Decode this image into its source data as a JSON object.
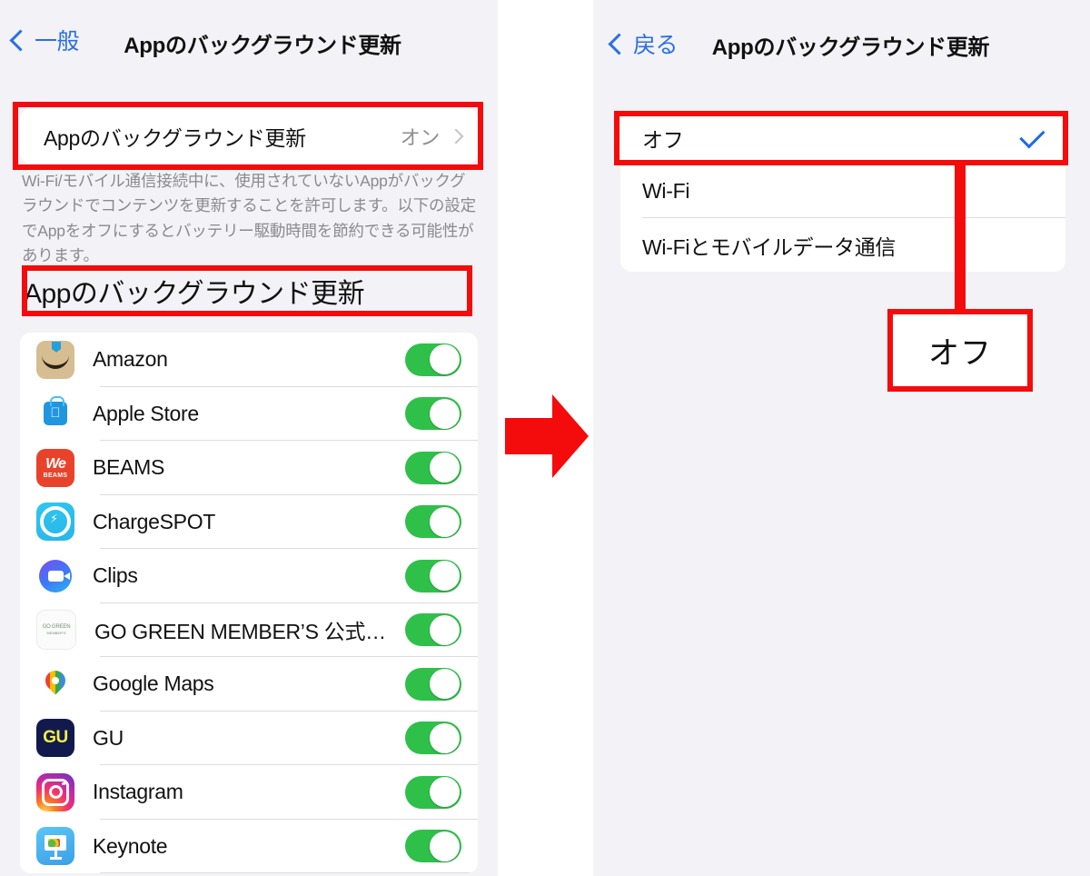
{
  "left_panel": {
    "nav": {
      "back_label": "一般",
      "title": "Appのバックグラウンド更新"
    },
    "bgrefresh_row": {
      "label": "Appのバックグラウンド更新",
      "value": "オン"
    },
    "footnote": "Wi-Fi/モバイル通信接続中に、使用されていないAppがバックグラウンドでコンテンツを更新することを許可します。以下の設定でAppをオフにするとバッテリー駆動時間を節約できる可能性があります。",
    "section_header": "Appのバックグラウンド更新",
    "apps": [
      {
        "name": "Amazon",
        "icon": "amazon-icon",
        "enabled": true
      },
      {
        "name": "Apple Store",
        "icon": "apple-store-icon",
        "enabled": true
      },
      {
        "name": "BEAMS",
        "icon": "beams-icon",
        "enabled": true
      },
      {
        "name": "ChargeSPOT",
        "icon": "chargespot-icon",
        "enabled": true
      },
      {
        "name": "Clips",
        "icon": "clips-icon",
        "enabled": true
      },
      {
        "name": "GO GREEN MEMBER’S 公式…",
        "icon": "go-green-icon",
        "enabled": true
      },
      {
        "name": "Google Maps",
        "icon": "google-maps-icon",
        "enabled": true
      },
      {
        "name": "GU",
        "icon": "gu-icon",
        "enabled": true
      },
      {
        "name": "Instagram",
        "icon": "instagram-icon",
        "enabled": true
      },
      {
        "name": "Keynote",
        "icon": "keynote-icon",
        "enabled": true
      }
    ]
  },
  "right_panel": {
    "nav": {
      "back_label": "戻る",
      "title": "Appのバックグラウンド更新"
    },
    "options": [
      {
        "label": "オフ",
        "selected": true
      },
      {
        "label": "Wi-Fi",
        "selected": false
      },
      {
        "label": "Wi-Fiとモバイルデータ通信",
        "selected": false
      }
    ]
  },
  "annotations": {
    "callout_text": "オフ",
    "highlight_color": "#f40b0b",
    "arrow_color": "#f40b0b"
  }
}
